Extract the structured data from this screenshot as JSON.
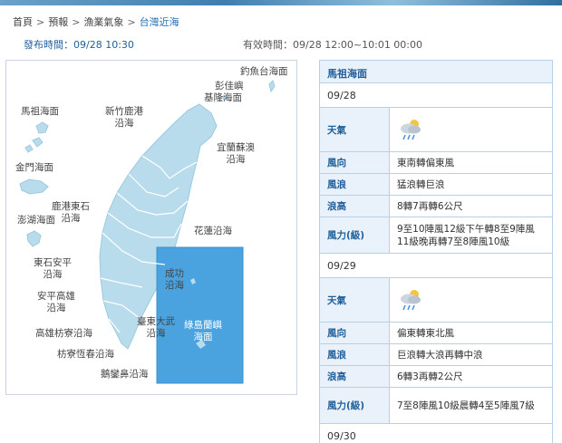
{
  "breadcrumb": [
    "首頁",
    "預報",
    "漁業氣象",
    "台灣近海"
  ],
  "breadcrumb_separator": ">",
  "issued": {
    "label": "發布時間",
    "value": "09/28 10:30"
  },
  "valid": {
    "label": "有效時間",
    "value": "09/28 12:00~10:01 00:00"
  },
  "map": {
    "labels": {
      "diaoyutai": "釣魚台海面",
      "pengjia": "彭佳嶼",
      "keelung": "基隆海面",
      "matsu": "馬祖海面",
      "hsinchu1": "新竹鹿港",
      "hsinchu2": "沿海",
      "yilan1": "宜蘭蘇澳",
      "yilan2": "沿海",
      "kinmen": "金門海面",
      "lugang1": "鹿港東石",
      "lugang2": "沿海",
      "penghu": "澎湖海面",
      "hualien": "花蓮沿海",
      "dongshi1": "東石安平",
      "dongshi2": "沿海",
      "chenggong1": "成功",
      "chenggong2": "沿海",
      "anping1": "安平高雄",
      "anping2": "沿海",
      "taitung": "臺東大武",
      "taitung2": "沿海",
      "lanyu1": "綠島蘭嶼",
      "lanyu2": "海面",
      "kaohsiung": "高雄枋寮沿海",
      "fangliao": "枋寮恆春沿海",
      "eluanbi": "鵝鑾鼻沿海"
    },
    "colors": {
      "land": "#b9dced",
      "highlight": "#4aa3de",
      "border": "#ffffff"
    }
  },
  "panel": {
    "title": "馬祖海面",
    "days": [
      {
        "date": "09/28",
        "weather_label": "天氣",
        "weather_icon": "cloud-rain-icon",
        "rows": [
          {
            "label": "風向",
            "value": "東南轉偏東風"
          },
          {
            "label": "風浪",
            "value": "猛浪轉巨浪"
          },
          {
            "label": "浪高",
            "value": "8轉7再轉6公尺"
          },
          {
            "label": "風力(級)",
            "value": "9至10陣風12級下午轉8至9陣風11級晚再轉7至8陣風10級"
          }
        ]
      },
      {
        "date": "09/29",
        "weather_label": "天氣",
        "weather_icon": "cloud-rain-icon",
        "rows": [
          {
            "label": "風向",
            "value": "偏東轉東北風"
          },
          {
            "label": "風浪",
            "value": "巨浪轉大浪再轉中浪"
          },
          {
            "label": "浪高",
            "value": "6轉3再轉2公尺"
          },
          {
            "label": "風力(級)",
            "value": "7至8陣風10級晨轉4至5陣風7級"
          }
        ]
      },
      {
        "date": "09/30"
      }
    ]
  }
}
